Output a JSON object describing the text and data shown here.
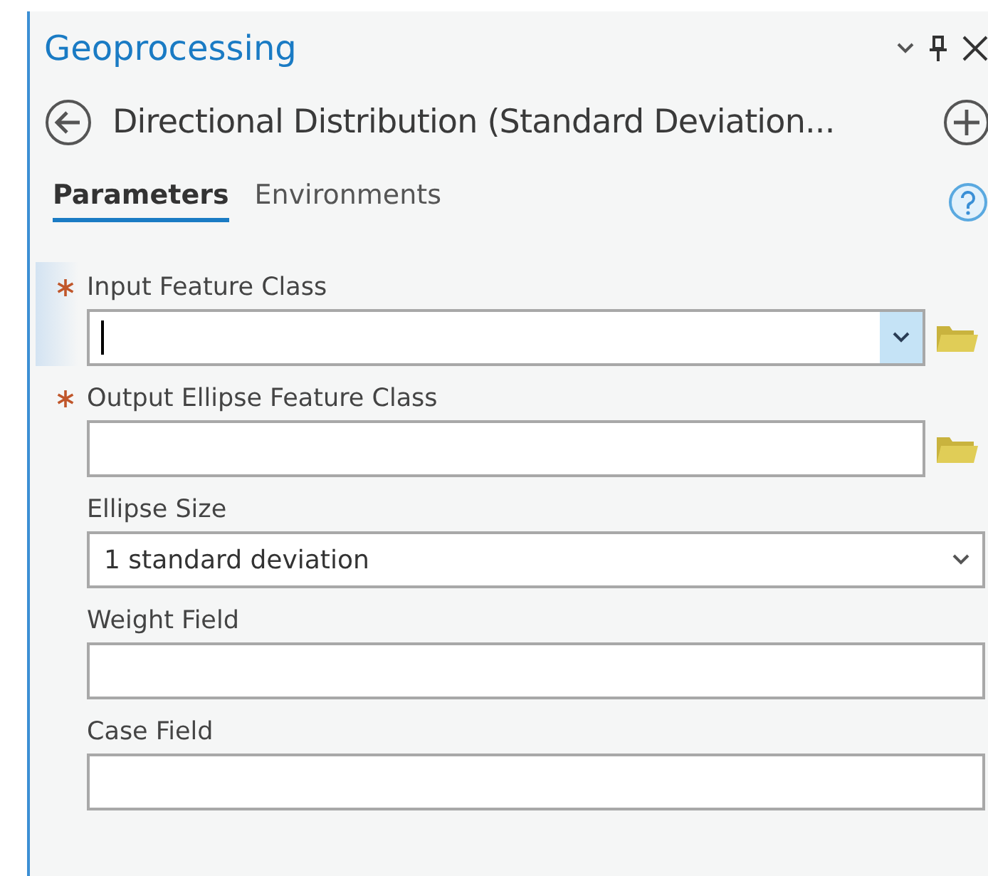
{
  "pane": {
    "title": "Geoprocessing"
  },
  "tool": {
    "name": "Directional Distribution (Standard Deviation..."
  },
  "tabs": [
    {
      "label": "Parameters",
      "selected": true
    },
    {
      "label": "Environments",
      "selected": false
    }
  ],
  "parameters": [
    {
      "kind": "dropdown-browse",
      "label": "Input Feature Class",
      "required": true,
      "focused": true
    },
    {
      "kind": "text-browse",
      "label": "Output Ellipse Feature Class",
      "required": true,
      "focused": false
    },
    {
      "kind": "dropdown",
      "label": "Ellipse Size",
      "required": false,
      "focused": false,
      "value": "1 standard deviation"
    },
    {
      "kind": "text",
      "label": "Weight Field",
      "required": false,
      "focused": false
    },
    {
      "kind": "text",
      "label": "Case Field",
      "required": false,
      "focused": false
    }
  ]
}
